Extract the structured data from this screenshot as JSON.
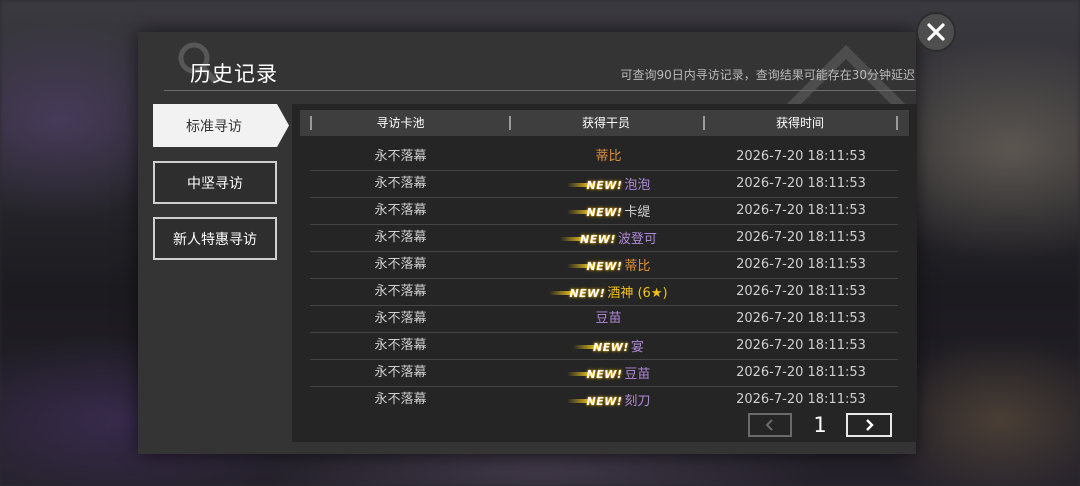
{
  "dialog": {
    "title": "历史记录",
    "subtitle": "可查询90日内寻访记录，查询结果可能存在30分钟延迟"
  },
  "tabs": [
    {
      "label": "标准寻访",
      "active": true
    },
    {
      "label": "中坚寻访",
      "active": false
    },
    {
      "label": "新人特惠寻访",
      "active": false
    }
  ],
  "table": {
    "headers": [
      "寻访卡池",
      "获得干员",
      "获得时间"
    ],
    "new_label": "NEW!",
    "rows": [
      {
        "pool": "永不落幕",
        "operator": "蒂比",
        "is_new": false,
        "color": "#e0903a",
        "time": "2026-7-20 18:11:53"
      },
      {
        "pool": "永不落幕",
        "operator": "泡泡",
        "is_new": true,
        "color": "#b08ad8",
        "time": "2026-7-20 18:11:53"
      },
      {
        "pool": "永不落幕",
        "operator": "卡缇",
        "is_new": true,
        "color": "#cfcfcf",
        "time": "2026-7-20 18:11:53"
      },
      {
        "pool": "永不落幕",
        "operator": "波登可",
        "is_new": true,
        "color": "#b08ad8",
        "time": "2026-7-20 18:11:53"
      },
      {
        "pool": "永不落幕",
        "operator": "蒂比",
        "is_new": true,
        "color": "#e0903a",
        "time": "2026-7-20 18:11:53"
      },
      {
        "pool": "永不落幕",
        "operator": "酒神 (6★)",
        "is_new": true,
        "color": "#f2c318",
        "time": "2026-7-20 18:11:53"
      },
      {
        "pool": "永不落幕",
        "operator": "豆苗",
        "is_new": false,
        "color": "#b08ad8",
        "time": "2026-7-20 18:11:53"
      },
      {
        "pool": "永不落幕",
        "operator": "宴",
        "is_new": true,
        "color": "#b08ad8",
        "time": "2026-7-20 18:11:53"
      },
      {
        "pool": "永不落幕",
        "operator": "豆苗",
        "is_new": true,
        "color": "#b08ad8",
        "time": "2026-7-20 18:11:53"
      },
      {
        "pool": "永不落幕",
        "operator": "刻刀",
        "is_new": true,
        "color": "#b08ad8",
        "time": "2026-7-20 18:11:53"
      }
    ]
  },
  "pagination": {
    "current_page": "1"
  },
  "icons": {
    "close": "close-icon",
    "prev": "chevron-left-icon",
    "next": "chevron-right-icon"
  }
}
